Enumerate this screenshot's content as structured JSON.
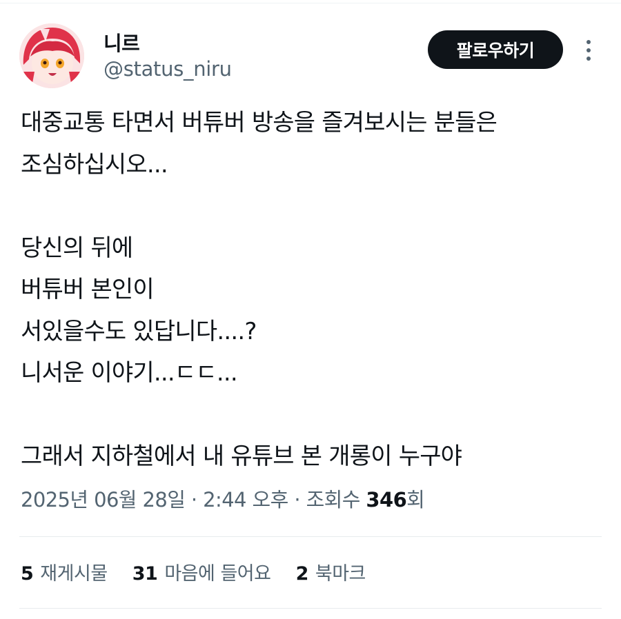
{
  "author": {
    "display_name": "니르",
    "handle": "@status_niru"
  },
  "header": {
    "follow_label": "팔로우하기",
    "more_icon": "more-vertical-icon"
  },
  "tweet": {
    "lines": [
      "대중교통 타면서 버튜버 방송을 즐겨보시는 분들은",
      "조심하십시오...",
      "",
      "당신의 뒤에",
      "버튜버 본인이",
      "서있을수도 있답니다....?",
      "니서운 이야기...ㄷㄷ...",
      "",
      "그래서 지하철에서 내 유튜브 본 개롱이 누구야"
    ]
  },
  "meta": {
    "date": "2025년 06월 28일",
    "time": "2:44 오후",
    "separator": "·",
    "views_prefix": "조회수 ",
    "views": "346",
    "views_suffix": "회"
  },
  "stats": {
    "reposts": {
      "count": "5",
      "label": "재게시물"
    },
    "likes": {
      "count": "31",
      "label": "마음에 들어요"
    },
    "bookmarks": {
      "count": "2",
      "label": "북마크"
    }
  },
  "colors": {
    "text": "#0f1419",
    "secondary": "#536471",
    "button_bg": "#0f1419",
    "divider": "#e7ebed"
  }
}
